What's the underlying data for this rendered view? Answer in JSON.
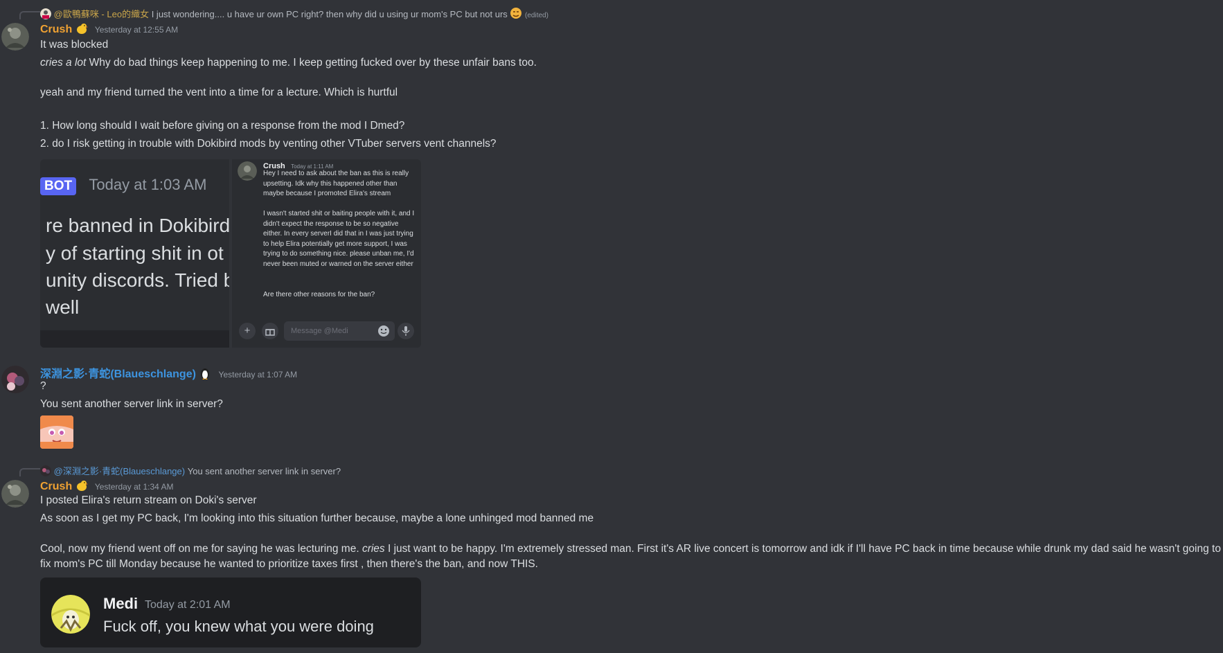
{
  "messages": {
    "crush1": {
      "reply": {
        "mention": "@歐鴨蘇咪 - Leo的織女",
        "text": "I just wondering.... u have ur own PC right? then why did u using ur mom's PC but not urs",
        "edited": "(edited)"
      },
      "username": "Crush",
      "timestamp": "Yesterday at 12:55 AM",
      "lines": {
        "l1": "It was blocked",
        "l2_em": "cries a lot",
        "l2": " Why do bad things keep happening to me. I keep getting fucked over by these unfair bans too.",
        "l3": "yeah and my friend turned the vent into a time for a lecture. Which is hurtful",
        "l4": "1. How long should I wait before giving on a response from the mod I Dmed?",
        "l5": "2. do I risk getting in trouble with Dokibird mods by venting other VTuber servers vent channels?"
      },
      "attachment_left": {
        "badge": "BOT",
        "timestamp": "Today at 1:03 AM",
        "line1": "re banned in Dokibird",
        "line2": "y of starting shit in ot",
        "line3": "unity discords. Tried ba",
        "line4": "well"
      },
      "attachment_right": {
        "username": "Crush",
        "timestamp": "Today at 1:11 AM",
        "para1": "Hey I need to ask about the ban as this is really upsetting. Idk why this happened other than maybe because I promoted Elira's stream",
        "para2": "I  wasn't started shit or baiting people with it, and I didn't expect the response to be so negative either. In every serverI did that in I was just trying to help Elira potentially get more support, I was trying to do something nice. please unban me, I'd never been muted or warned on the server either",
        "para3": "Are there other reasons for the ban?",
        "composer_placeholder": "Message @Medi"
      }
    },
    "blaue": {
      "username": "深淵之影·青蛇(Blaueschlange)",
      "timestamp": "Yesterday at 1:07 AM",
      "l1": "?",
      "l2": "You sent another server link in server?"
    },
    "crush2": {
      "reply": {
        "mention": "@深淵之影·青蛇(Blaueschlange)",
        "text": "You sent another server link in server?"
      },
      "username": "Crush",
      "timestamp": "Yesterday at 1:34 AM",
      "l1": "I posted Elira's return stream on Doki's server",
      "l2": "As soon as I get my PC back, I'm looking into this situation further because, maybe a lone unhinged mod banned me",
      "l3a": "Cool, now my friend went off on me for saying he was lecturing me. ",
      "l3_em": "cries",
      "l3b": " I just want to be happy. I'm extremely stressed man. First it's AR live concert is tomorrow and idk if I'll have PC back in time because while drunk my dad said he wasn't going to",
      "l4": "fix mom's PC till Monday because he wanted to prioritize taxes first , then there's the ban, and now THIS.",
      "embed": {
        "username": "Medi",
        "timestamp": "Today at 2:01 AM",
        "text": "Fuck off, you knew what you were doing"
      }
    }
  },
  "colors": {
    "background": "#313338",
    "crush_name": "#f0a232",
    "blaue_name": "#3d94e0",
    "bot_badge": "#5865f2"
  },
  "icons": [
    "plus-icon",
    "gift-icon",
    "emoji-icon",
    "mic-icon",
    "chick-emoji-icon",
    "penguin-emoji-icon"
  ]
}
